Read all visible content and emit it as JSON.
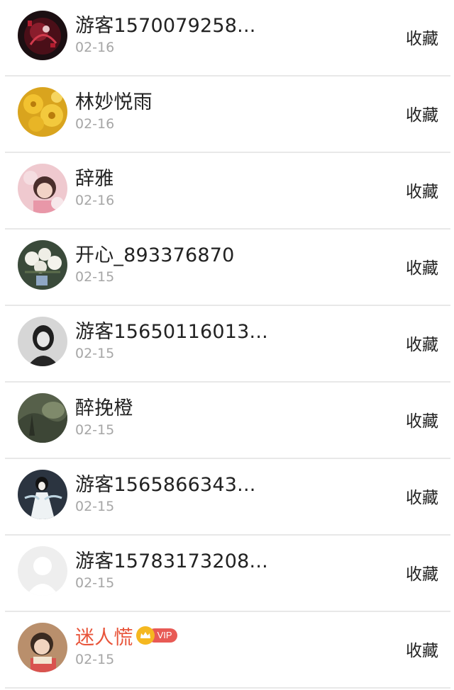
{
  "items": [
    {
      "name": "游客1570079258...",
      "date": "02-16",
      "action": "收藏",
      "avatar": "dark-red-art-avatar"
    },
    {
      "name": "林妙悦雨",
      "date": "02-16",
      "action": "收藏",
      "avatar": "yellow-flowers-avatar"
    },
    {
      "name": "辞雅",
      "date": "02-16",
      "action": "收藏",
      "avatar": "pink-girl-avatar"
    },
    {
      "name": "开心_893376870",
      "date": "02-15",
      "action": "收藏",
      "avatar": "white-flowers-avatar"
    },
    {
      "name": "游客15650116013...",
      "date": "02-15",
      "action": "收藏",
      "avatar": "gray-woman-avatar"
    },
    {
      "name": "醉挽橙",
      "date": "02-15",
      "action": "收藏",
      "avatar": "green-landscape-avatar"
    },
    {
      "name": "游客1565866343...",
      "date": "02-15",
      "action": "收藏",
      "avatar": "traditional-costume-avatar"
    },
    {
      "name": "游客15783173208...",
      "date": "02-15",
      "action": "收藏",
      "avatar": "default-user-avatar"
    },
    {
      "name": "迷人慌",
      "date": "02-15",
      "action": "收藏",
      "avatar": "child-reading-avatar",
      "vip_label": "VIP"
    }
  ],
  "colors": {
    "name": "#222222",
    "vip_name": "#e8543a",
    "date": "#a6a6a6",
    "divider": "#e8e8e8",
    "vip_badge": "#e85a55",
    "crown": "#f5b820"
  }
}
